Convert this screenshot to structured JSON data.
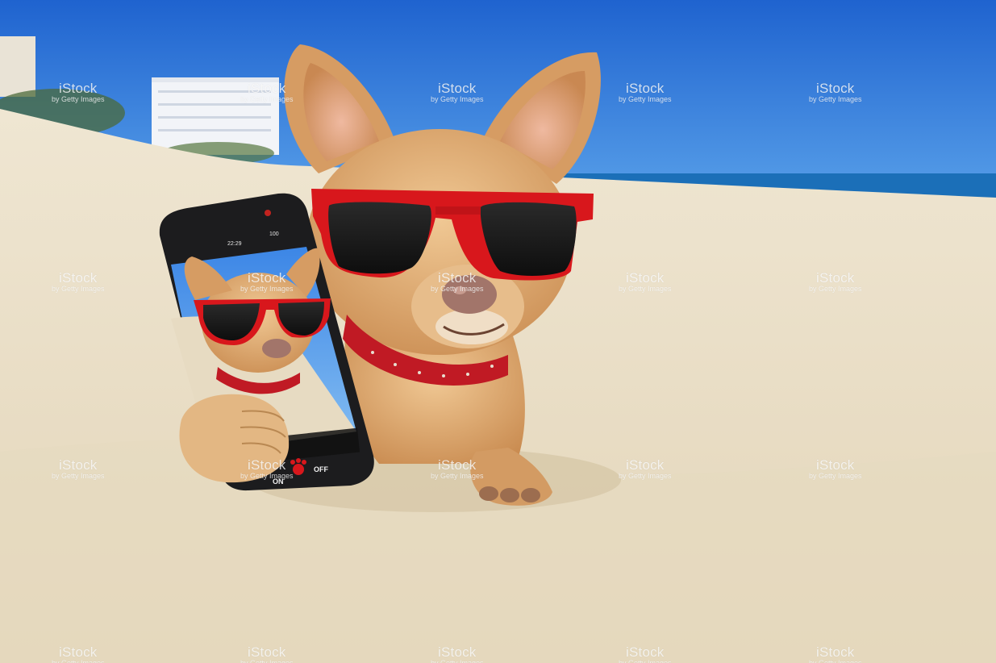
{
  "watermark": {
    "brand": "iStock",
    "sub": "by Getty Images"
  },
  "phone": {
    "status_time": "22:29",
    "status_battery": "100",
    "camera_on_label": "ON",
    "camera_off_label": "OFF"
  },
  "colors": {
    "sky": "#2f74d8",
    "sand": "#e8dcc2",
    "fur": "#d9a46c",
    "glasses": "#d8171c",
    "phone": "#1c1c1e"
  },
  "icons": {
    "shutter": "paw-icon"
  }
}
